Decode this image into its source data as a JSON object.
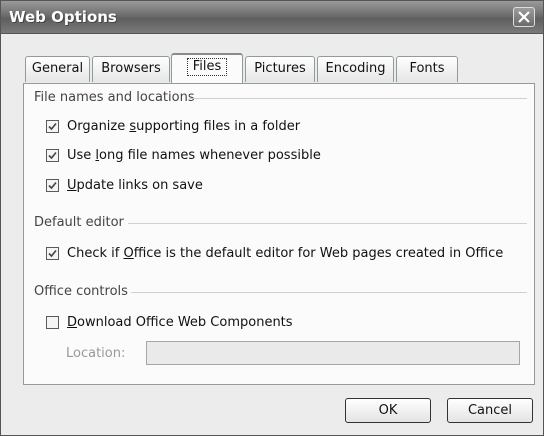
{
  "window": {
    "title": "Web Options"
  },
  "tabs": [
    {
      "label": "General"
    },
    {
      "label": "Browsers"
    },
    {
      "label": "Files"
    },
    {
      "label": "Pictures"
    },
    {
      "label": "Encoding"
    },
    {
      "label": "Fonts"
    }
  ],
  "active_tab": "Files",
  "groups": {
    "file_names": {
      "header": "File names and locations",
      "options": [
        {
          "before": "Organize ",
          "mnemonic": "s",
          "after": "upporting files in a folder",
          "checked": true
        },
        {
          "before": "Use ",
          "mnemonic": "l",
          "after": "ong file names whenever possible",
          "checked": true
        },
        {
          "before": "",
          "mnemonic": "U",
          "after": "pdate links on save",
          "checked": true
        }
      ]
    },
    "default_editor": {
      "header": "Default editor",
      "options": [
        {
          "before": "Check if ",
          "mnemonic": "O",
          "after": "ffice is the default editor for Web pages created in Office",
          "checked": true
        }
      ]
    },
    "office_controls": {
      "header": "Office controls",
      "options": [
        {
          "before": "",
          "mnemonic": "D",
          "after": "ownload Office Web Components",
          "checked": false
        }
      ],
      "location_label": "Location:",
      "location_value": ""
    }
  },
  "buttons": {
    "ok": "OK",
    "cancel": "Cancel"
  },
  "colors": {
    "titlebar": "#6d6d6d",
    "dialog_bg": "#ececec",
    "panel_bg": "#fbfbfb"
  }
}
